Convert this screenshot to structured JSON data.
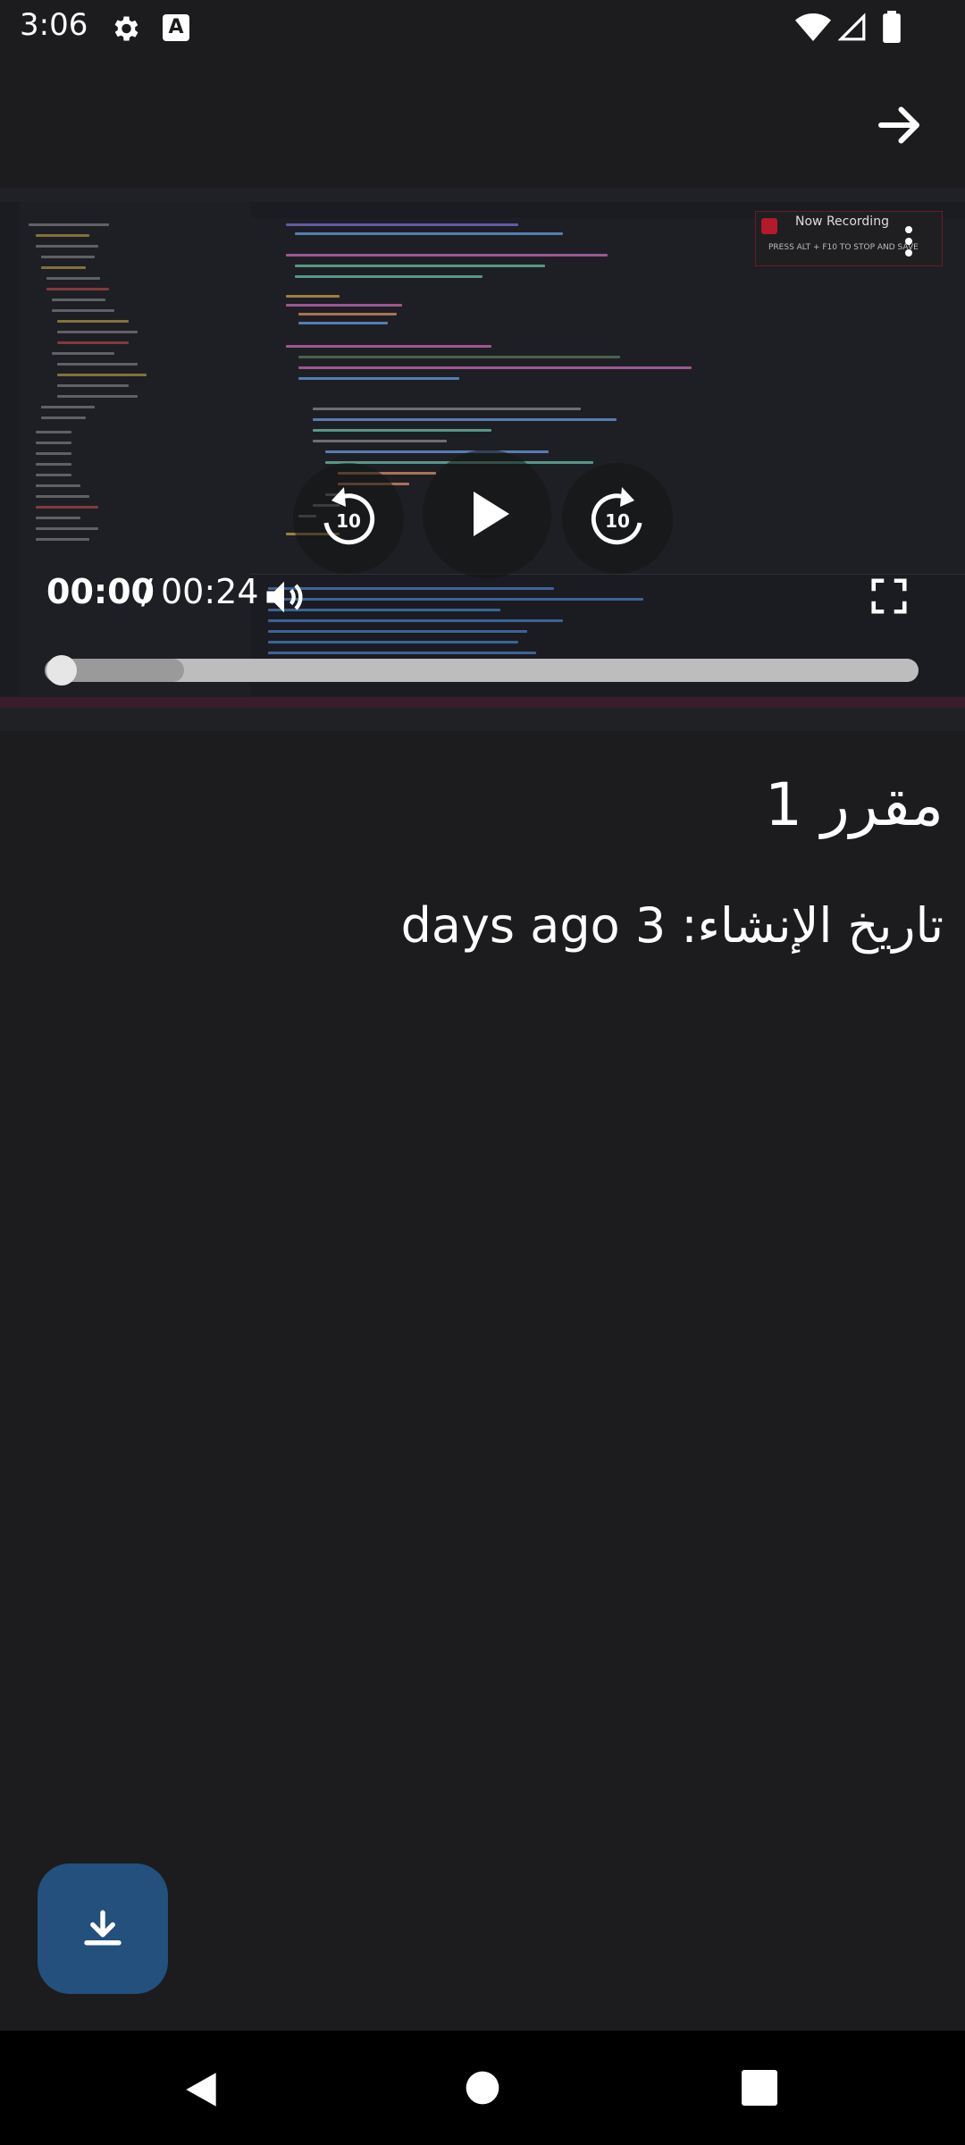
{
  "status_bar": {
    "time": "3:06",
    "icons": [
      "gear-icon",
      "a-box-icon",
      "wifi-icon",
      "signal-icon",
      "battery-icon"
    ]
  },
  "header": {
    "forward_icon": "arrow-right-icon"
  },
  "video_player": {
    "current_time": "00:00",
    "separator": "/",
    "duration": "00:24",
    "progress_fraction": 0.0,
    "buffered_fraction": 0.1,
    "rewind_seconds": "10",
    "forward_seconds": "10",
    "icons": [
      "rewind-10-icon",
      "play-icon",
      "forward-10-icon",
      "volume-icon",
      "fullscreen-icon"
    ],
    "recording_overlay": {
      "title": "Now Recording",
      "hint": "PRESS ALT + F10 TO STOP AND SAVE"
    }
  },
  "course": {
    "title": "مقرر 1",
    "created_label": "تاريخ الإنشاء: 3 days ago"
  },
  "download_button": {
    "icon": "download-icon",
    "color": "#23507d"
  },
  "nav_bar": {
    "icons": [
      "back-icon",
      "home-icon",
      "recents-icon"
    ]
  }
}
